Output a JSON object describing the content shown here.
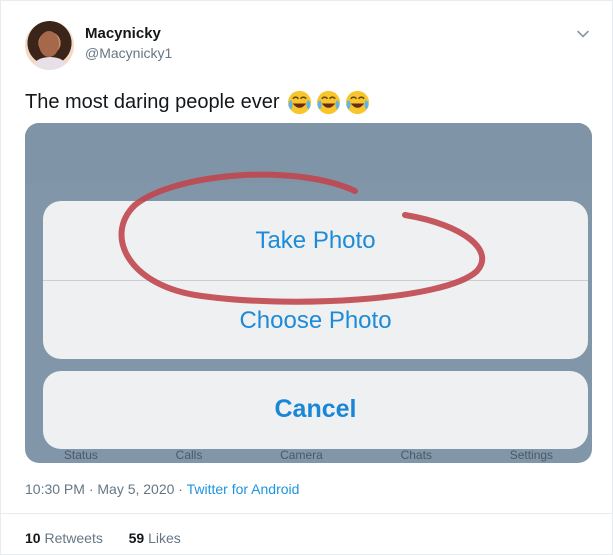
{
  "tweet": {
    "display_name": "Macynicky",
    "handle": "@Macynicky1",
    "text": "The most daring people ever",
    "emoji_icon": "face-with-tears-of-joy",
    "emoji_count": 3,
    "timestamp": "10:30 PM · May 5, 2020 ·",
    "source": "Twitter for Android",
    "retweets_count": "10",
    "retweets_label": "Retweets",
    "likes_count": "59",
    "likes_label": "Likes"
  },
  "media": {
    "take_photo": "Take Photo",
    "choose_photo": "Choose Photo",
    "cancel": "Cancel",
    "tabs": [
      "Status",
      "Calls",
      "Camera",
      "Chats",
      "Settings"
    ],
    "circle_color": "#c0464f"
  },
  "colors": {
    "link": "#1b95e0",
    "muted": "#657786",
    "text": "#14171a",
    "ios_blue": "#1d8bd6"
  }
}
